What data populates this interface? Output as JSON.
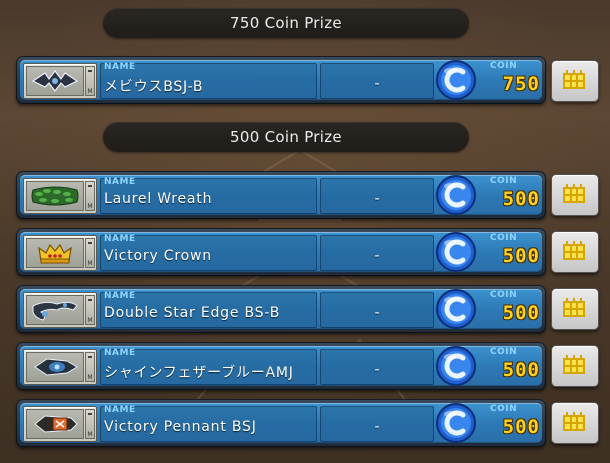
{
  "sections": [
    {
      "header": "750 Coin Prize",
      "items": [
        {
          "name_caption": "NAME",
          "name": "メビウスBSJ-B",
          "extra": "-",
          "coin_caption": "COIN",
          "coin": "750",
          "icon": "winged-emblem-icon"
        }
      ]
    },
    {
      "header": "500 Coin Prize",
      "items": [
        {
          "name_caption": "NAME",
          "name": "Laurel Wreath",
          "extra": "-",
          "coin_caption": "COIN",
          "coin": "500",
          "icon": "laurel-wreath-icon"
        },
        {
          "name_caption": "NAME",
          "name": "Victory Crown",
          "extra": "-",
          "coin_caption": "COIN",
          "coin": "500",
          "icon": "crown-icon"
        },
        {
          "name_caption": "NAME",
          "name": "Double Star Edge BS-B",
          "extra": "-",
          "coin_caption": "COIN",
          "coin": "500",
          "icon": "double-star-edge-icon"
        },
        {
          "name_caption": "NAME",
          "name": "シャインフェザーブルーAMJ",
          "extra": "-",
          "coin_caption": "COIN",
          "coin": "500",
          "icon": "shine-feather-icon"
        },
        {
          "name_caption": "NAME",
          "name": "Victory Pennant BSJ",
          "extra": "-",
          "coin_caption": "COIN",
          "coin": "500",
          "icon": "pennant-icon"
        }
      ]
    }
  ],
  "colors": {
    "row_blue": "#3c93cf",
    "coin_gold": "#ffd31f",
    "caption_blue": "#8fd3ff",
    "header_bg": "#24201c"
  },
  "icons": {
    "coin": "coin-icon",
    "grid_button": "grid-icon"
  }
}
